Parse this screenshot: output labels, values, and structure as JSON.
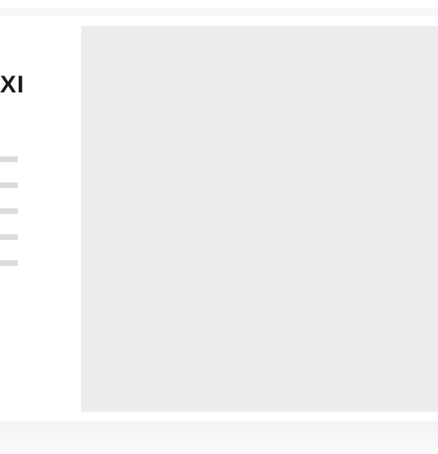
{
  "header": {
    "title": "XI"
  },
  "menu": {
    "items": [
      {
        "label": ""
      },
      {
        "label": ""
      },
      {
        "label": ""
      },
      {
        "label": ""
      },
      {
        "label": ""
      }
    ]
  },
  "colors": {
    "placeholder": "#ededed",
    "menu_line": "#dcdcdc",
    "title": "#1c1c1c"
  }
}
